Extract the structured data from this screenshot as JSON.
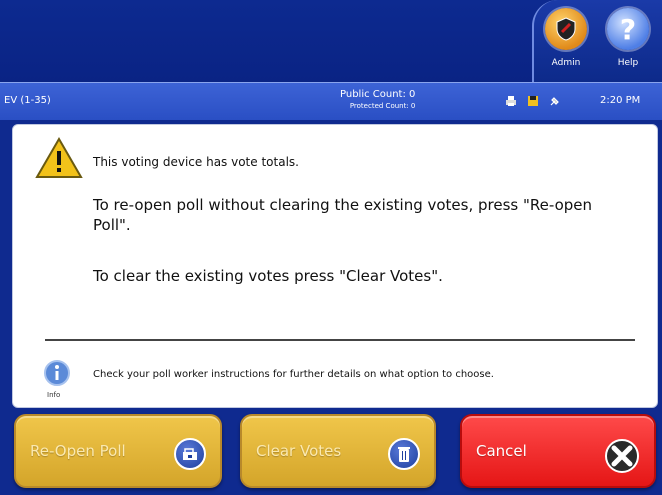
{
  "header": {
    "admin_label": "Admin",
    "help_label": "Help"
  },
  "status_bar": {
    "precinct": "EV (1-35)",
    "public_count": "Public Count: 0",
    "protected_count": "Protected Count: 0",
    "time": "2:20 PM"
  },
  "dialog": {
    "warning_title": "This voting device has vote totals.",
    "reopen_message": "To re-open poll without clearing the existing votes, press \"Re-open Poll\".",
    "clear_message": "To clear the existing votes press \"Clear Votes\".",
    "info_label": "Info",
    "instructions": "Check your poll worker instructions for further details on what option to choose."
  },
  "buttons": {
    "reopen_label": "Re-Open Poll",
    "clear_label": "Clear Votes",
    "cancel_label": "Cancel"
  },
  "colors": {
    "background": "#0f2a8f",
    "status_bar": "#3358cc",
    "gold_button": "#e0b23a",
    "cancel_button": "#f02020",
    "warning": "#f2c21a"
  },
  "icons": {
    "admin": "shield-icon",
    "help": "question-icon",
    "warning": "warning-triangle-icon",
    "info": "info-icon",
    "print": "printer-icon",
    "save": "floppy-disk-icon",
    "power": "plug-icon",
    "reopen": "reopen-icon",
    "clear": "trash-icon",
    "cancel": "close-icon"
  }
}
